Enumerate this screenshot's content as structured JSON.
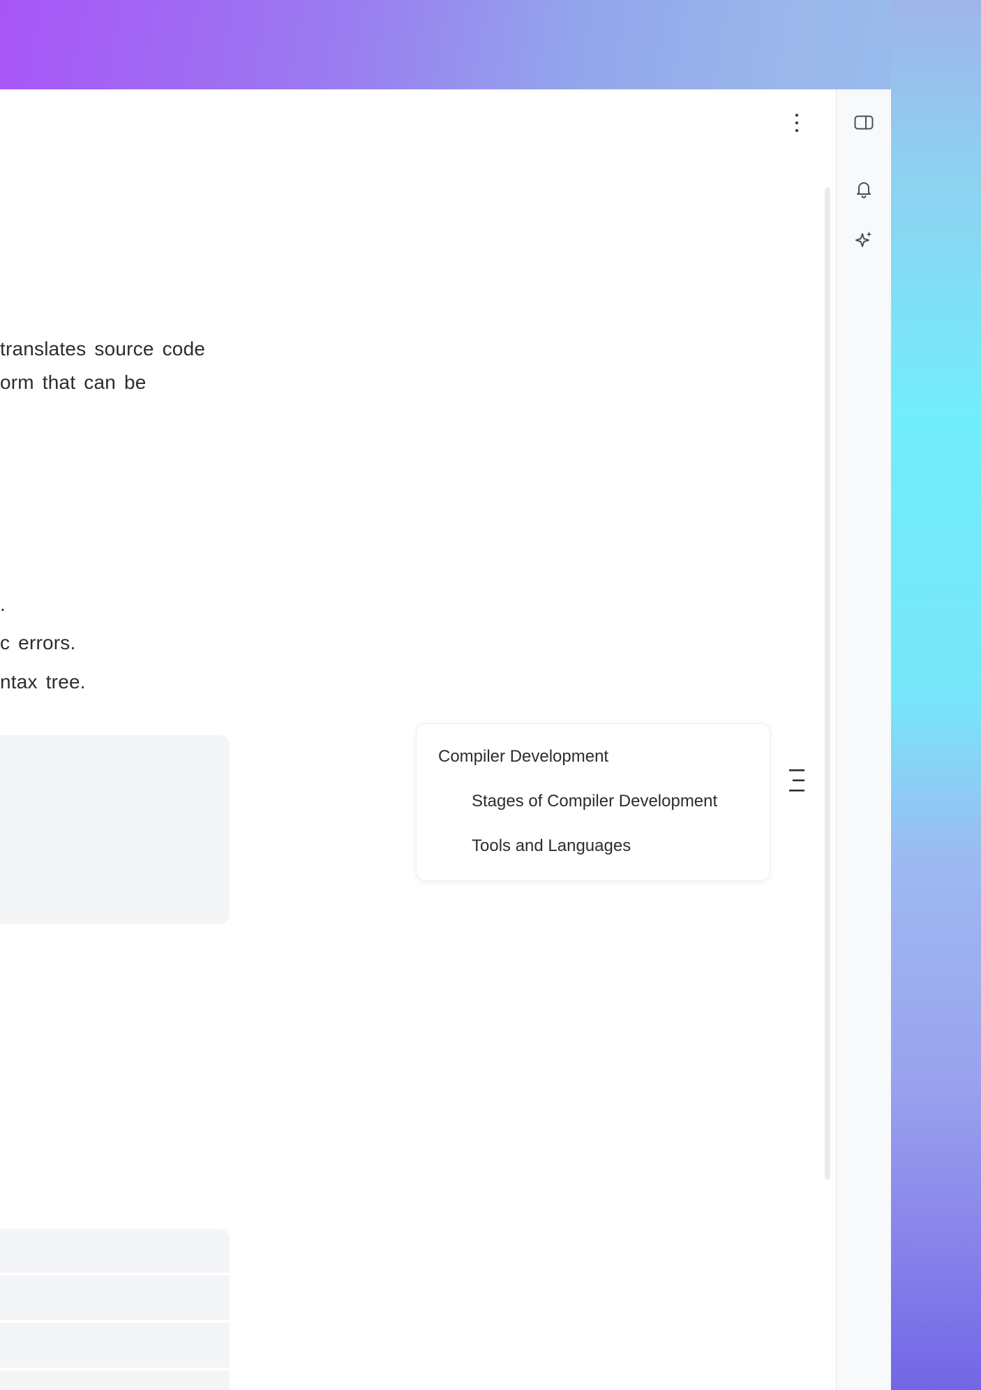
{
  "theme": {
    "accent_top": "#a855f7",
    "accent_mid": "#72edfa",
    "accent_bottom": "#7468e6",
    "text_color": "#2a2d31",
    "code_bg": "#f4f5f7"
  },
  "header": {
    "more_icon": "more-vertical-icon"
  },
  "right_rail": {
    "icons": [
      "panel-toggle-icon",
      "bell-icon",
      "sparkle-icon"
    ]
  },
  "content": {
    "paragraph_lines": [
      "translates source code",
      "orm that can be"
    ],
    "list_lines": [
      ".",
      "c errors.",
      "ntax tree."
    ]
  },
  "toc": {
    "toggle_icon": "table-of-contents-icon",
    "items": [
      {
        "label": "Compiler Development",
        "level": 1
      },
      {
        "label": "Stages of Compiler Development",
        "level": 2
      },
      {
        "label": "Tools and Languages",
        "level": 2
      }
    ]
  }
}
